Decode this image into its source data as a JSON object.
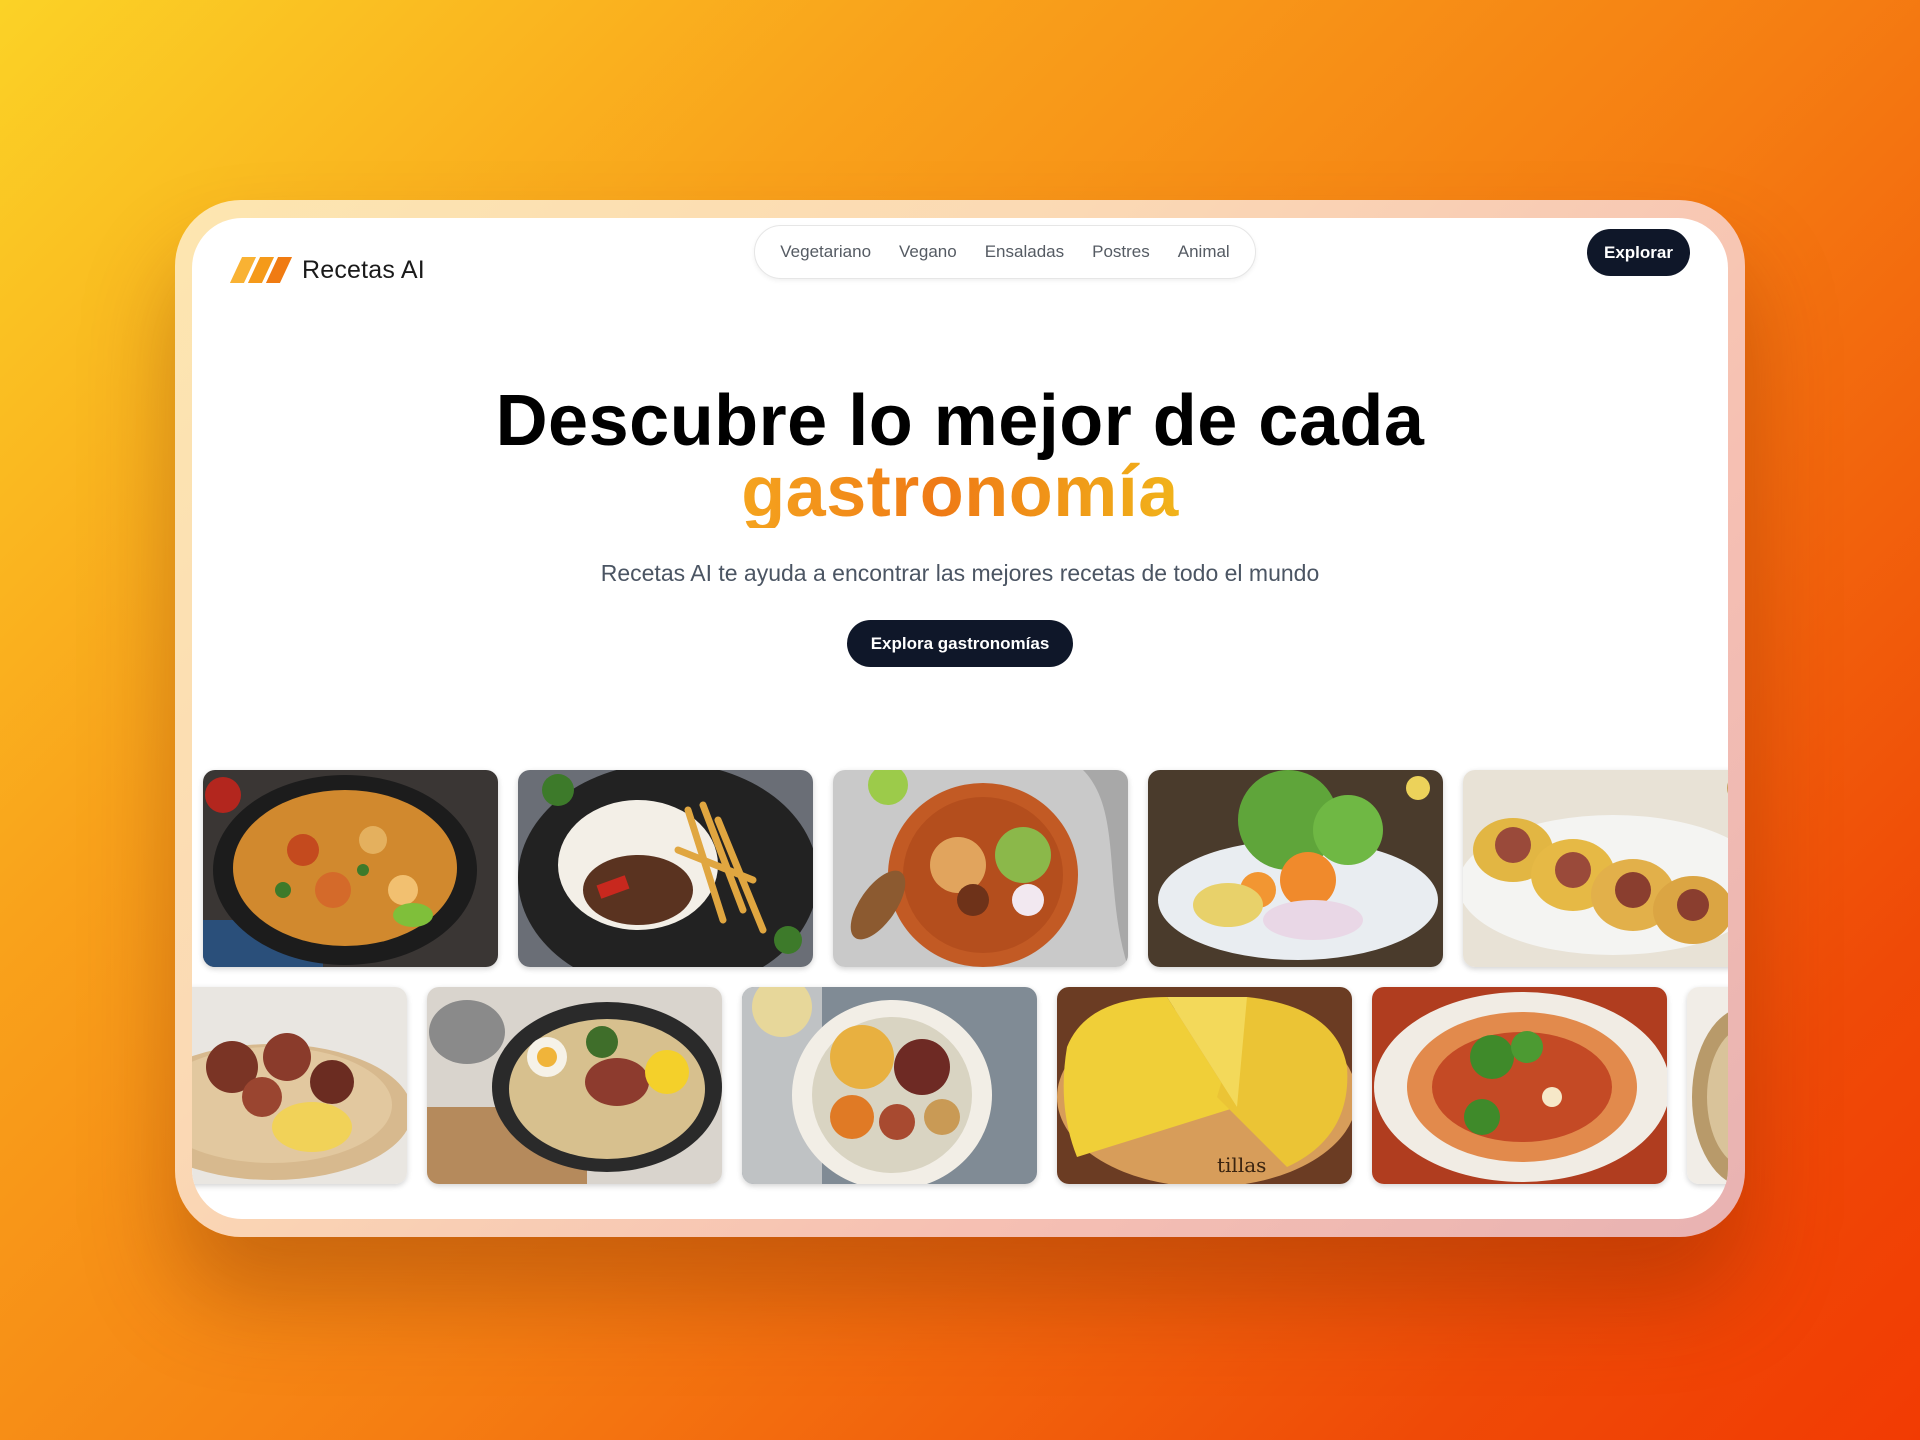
{
  "brand": {
    "name": "Recetas AI",
    "logo_colors": [
      "#f9b233",
      "#f59a1a",
      "#f07b12"
    ]
  },
  "nav": {
    "items": [
      "Vegetariano",
      "Vegano",
      "Ensaladas",
      "Postres",
      "Animal"
    ]
  },
  "header": {
    "explore_label": "Explorar"
  },
  "hero": {
    "title_line1": "Descubre lo mejor de cada",
    "title_accent": "gastronomía",
    "subtitle": "Recetas AI te ayuda a encontrar las mejores recetas de todo el mundo",
    "cta_label": "Explora gastronomías"
  },
  "colors": {
    "dark_button": "#0f1729",
    "accent_start": "#f5a41e",
    "accent_end": "#ef7a16"
  },
  "gallery": {
    "row1": [
      "paella-image",
      "lomo-saltado-image",
      "bean-salad-bowl-image",
      "ceviche-image",
      "tacos-image"
    ],
    "row2": [
      "pulpo-image",
      "ramen-image",
      "cocido-image",
      "tortilla-image",
      "spaghetti-image",
      "partial-dish-image"
    ]
  }
}
